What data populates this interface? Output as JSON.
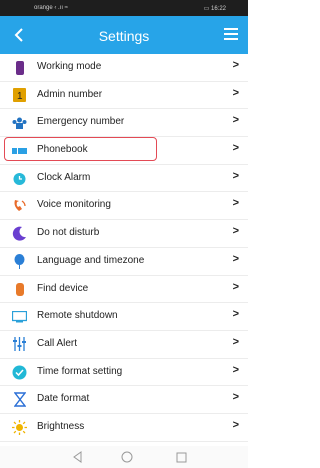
{
  "status": {
    "left": "orange ‹ .ıı ≈",
    "right": "▭ 16:22"
  },
  "header": {
    "title": "Settings"
  },
  "items": [
    {
      "label": "Working mode",
      "icon": "phone-icon",
      "color": "#6b2d8a"
    },
    {
      "label": "Admin number",
      "icon": "number-one-icon",
      "color": "#e0a000"
    },
    {
      "label": "Emergency number",
      "icon": "people-icon",
      "color": "#2273c2"
    },
    {
      "label": "Phonebook",
      "icon": "phonebook-icon",
      "color": "#2aa0e4"
    },
    {
      "label": "Clock Alarm",
      "icon": "alarm-clock-icon",
      "color": "#27b9d9"
    },
    {
      "label": "Voice monitoring",
      "icon": "monitoring-icon",
      "color": "#e86b2a"
    },
    {
      "label": "Do not disturb",
      "icon": "moon-icon",
      "color": "#6a3fd0"
    },
    {
      "label": "Language and timezone",
      "icon": "balloon-icon",
      "color": "#2a7fd6"
    },
    {
      "label": "Find device",
      "icon": "device-icon",
      "color": "#e87a2a"
    },
    {
      "label": "Remote shutdown",
      "icon": "screen-icon",
      "color": "#2aa0d9"
    },
    {
      "label": "Call Alert",
      "icon": "sliders-icon",
      "color": "#2a7fd6"
    },
    {
      "label": "Time format setting",
      "icon": "time-check-icon",
      "color": "#21b8d6"
    },
    {
      "label": "Date format",
      "icon": "hourglass-icon",
      "color": "#2a6fd6"
    },
    {
      "label": "Brightness",
      "icon": "sun-icon",
      "color": "#f0b400"
    }
  ],
  "chevron": ">"
}
